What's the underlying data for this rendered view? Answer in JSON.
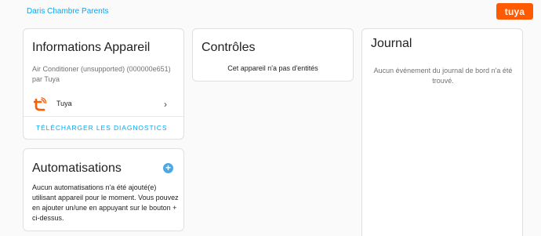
{
  "breadcrumb": "Daris Chambre Parents",
  "logo_text": "tuya",
  "device_info": {
    "title": "Informations Appareil",
    "model": "Air Conditioner (unsupported) (000000e651)",
    "by_line": "par Tuya",
    "manufacturer": "Tuya",
    "manufacturer_icon": "tuya-icon",
    "download_diagnostics": "TÉLÉCHARGER LES DIAGNOSTICS"
  },
  "automations": {
    "title": "Automatisations",
    "empty_text": "Aucun automatisations n'a été ajouté(e) utilisant appareil pour le moment. Vous pouvez en ajouter un/une en appuyant sur le bouton + ci-dessus."
  },
  "controls": {
    "title": "Contrôles",
    "empty_text": "Cet appareil n'a pas d'entités"
  },
  "journal": {
    "title": "Journal",
    "empty_text": "Aucun événement du journal de bord n'a été trouvé."
  },
  "colors": {
    "accent": "#03a9f4",
    "tuya_orange": "#ff5a00",
    "add_button": "#4da9e4"
  }
}
